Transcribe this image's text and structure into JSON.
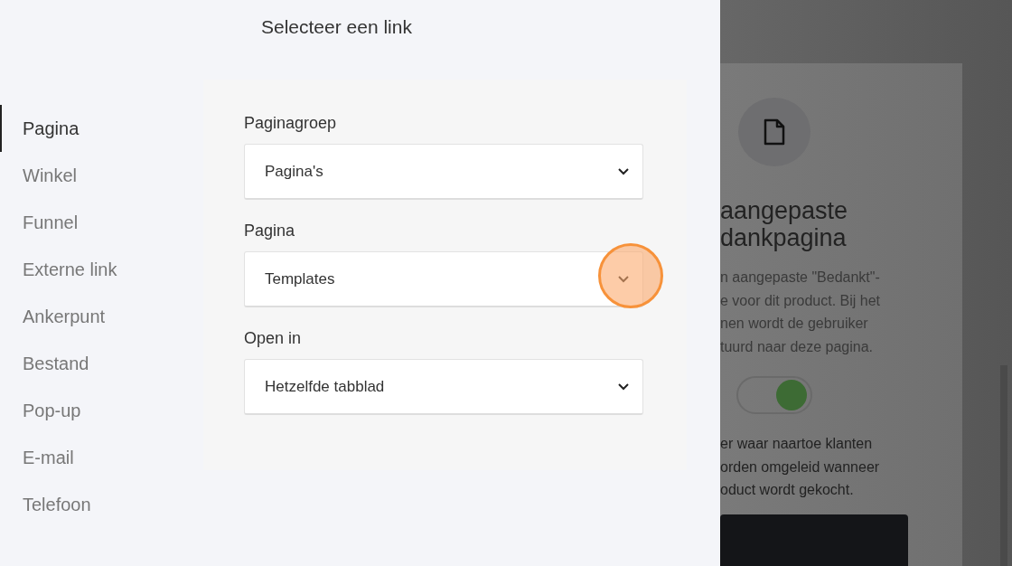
{
  "dialog": {
    "title": "Selecteer een link"
  },
  "link_types": [
    {
      "label": "Pagina",
      "selected": true
    },
    {
      "label": "Winkel",
      "selected": false
    },
    {
      "label": "Funnel",
      "selected": false
    },
    {
      "label": "Externe link",
      "selected": false
    },
    {
      "label": "Ankerpunt",
      "selected": false
    },
    {
      "label": "Bestand",
      "selected": false
    },
    {
      "label": "Pop-up",
      "selected": false
    },
    {
      "label": "E-mail",
      "selected": false
    },
    {
      "label": "Telefoon",
      "selected": false
    }
  ],
  "fields": [
    {
      "label": "Paginagroep",
      "value": "Pagina's",
      "highlighted": false
    },
    {
      "label": "Pagina",
      "value": "Templates",
      "highlighted": true
    },
    {
      "label": "Open in",
      "value": "Hetzelfde tabblad",
      "highlighted": false
    }
  ],
  "background_page": {
    "heading_lines": [
      "aangepaste",
      "dankpagina"
    ],
    "description_lines": [
      "n aangepaste \"Bedankt\"-",
      "e voor dit product. Bij het",
      "nen wordt de gebruiker",
      "tuurd naar deze pagina."
    ],
    "toggle": {
      "on": true
    },
    "help_lines": [
      "er waar naartoe klanten",
      "orden omgeleid wanneer",
      "oduct wordt gekocht."
    ]
  }
}
